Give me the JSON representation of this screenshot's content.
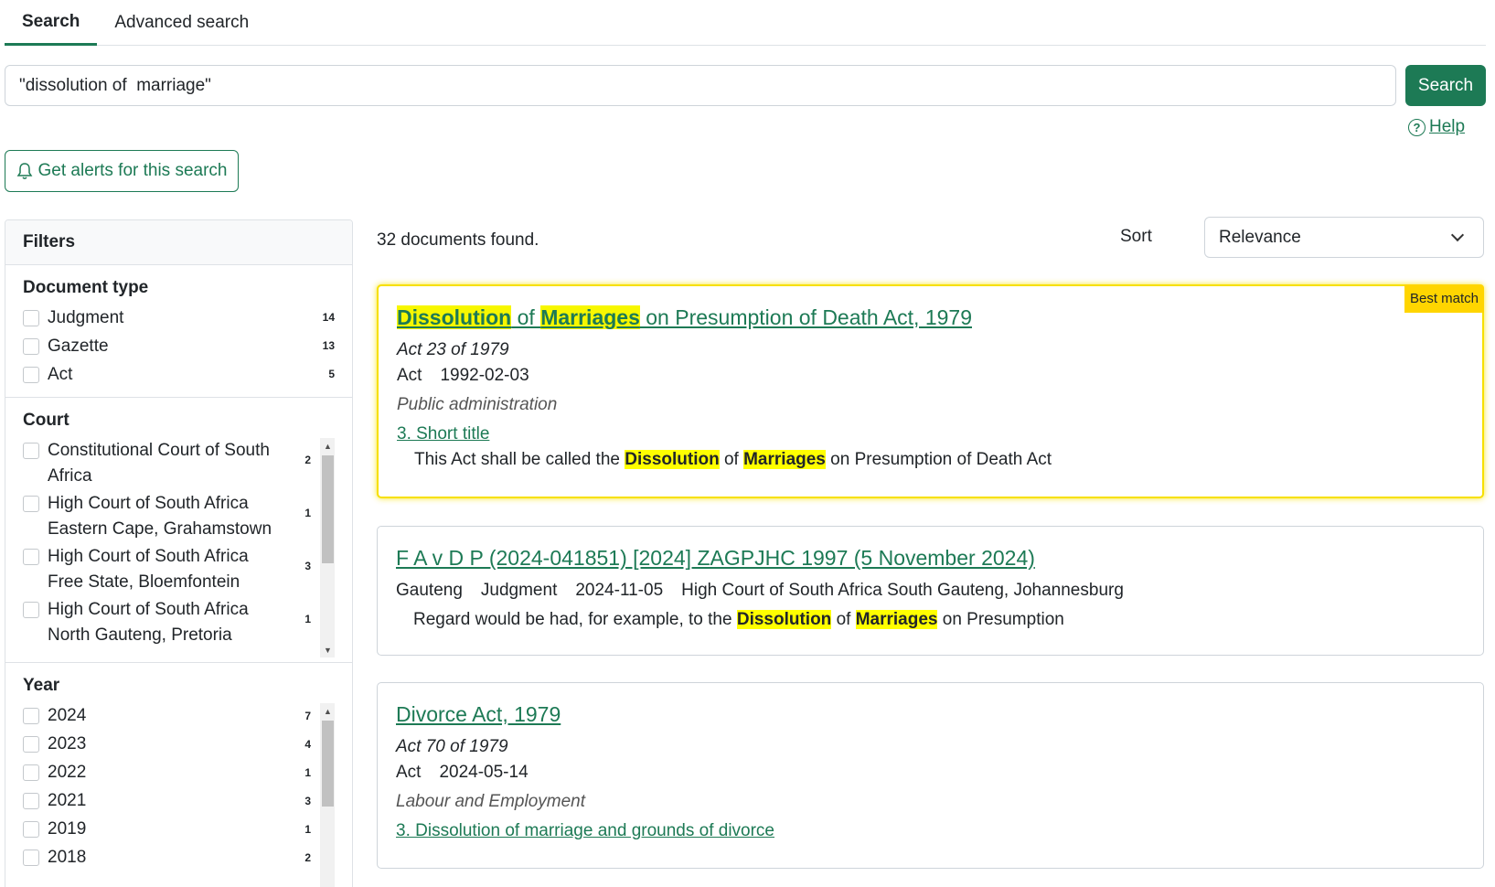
{
  "tabs": [
    {
      "label": "Search",
      "active": true
    },
    {
      "label": "Advanced search",
      "active": false
    }
  ],
  "search": {
    "value": "\"dissolution of  marriage\"",
    "button_label": "Search"
  },
  "help_label": "Help",
  "alerts_button": "Get alerts for this search",
  "filters": {
    "header": "Filters",
    "document_type": {
      "title": "Document type",
      "options": [
        {
          "label": "Judgment",
          "count": "14"
        },
        {
          "label": "Gazette",
          "count": "13"
        },
        {
          "label": "Act",
          "count": "5"
        }
      ]
    },
    "court": {
      "title": "Court",
      "options": [
        {
          "label": "Constitutional Court of South Africa",
          "count": "2"
        },
        {
          "label": "High Court of South Africa Eastern Cape, Grahamstown",
          "count": "1"
        },
        {
          "label": "High Court of South Africa Free State, Bloemfontein",
          "count": "3"
        },
        {
          "label": "High Court of South Africa North Gauteng, Pretoria",
          "count": "1"
        }
      ]
    },
    "year": {
      "title": "Year",
      "options": [
        {
          "label": "2024",
          "count": "7"
        },
        {
          "label": "2023",
          "count": "4"
        },
        {
          "label": "2022",
          "count": "1"
        },
        {
          "label": "2021",
          "count": "3"
        },
        {
          "label": "2019",
          "count": "1"
        },
        {
          "label": "2018",
          "count": "2"
        }
      ]
    }
  },
  "results": {
    "found_text": "32 documents found.",
    "sort_label": "Sort",
    "sort_value": "Relevance",
    "items": [
      {
        "badge": "Best match",
        "title_parts": [
          "Dissolution",
          " of ",
          "Marriages",
          " on Presumption of Death Act, 1979"
        ],
        "citation": "Act 23 of 1979",
        "doc_type": "Act",
        "date": "1992-02-03",
        "subject": "Public administration",
        "provision": "3. Short title",
        "snippet_parts": [
          "This Act shall be called the ",
          "Dissolution",
          " of ",
          "Marriages",
          " on Presumption of Death Act"
        ]
      },
      {
        "title": "F A v D P (2024-041851) [2024] ZAGPJHC 1997 (5 November 2024)",
        "location": "Gauteng",
        "doc_type": "Judgment",
        "date": "2024-11-05",
        "court": "High Court of South Africa South Gauteng, Johannesburg",
        "snippet_parts": [
          "Regard would be had, for example, to the ",
          "Dissolution",
          " of ",
          "Marriages",
          " on Presumption"
        ]
      },
      {
        "title": "Divorce Act, 1979",
        "citation": "Act 70 of 1979",
        "doc_type": "Act",
        "date": "2024-05-14",
        "subject": "Labour and Employment",
        "provision": "3. Dissolution of marriage and grounds of divorce"
      }
    ]
  },
  "colors": {
    "brand": "#1d7a55",
    "highlight": "#ffff00",
    "best_match": "#ffd500"
  }
}
